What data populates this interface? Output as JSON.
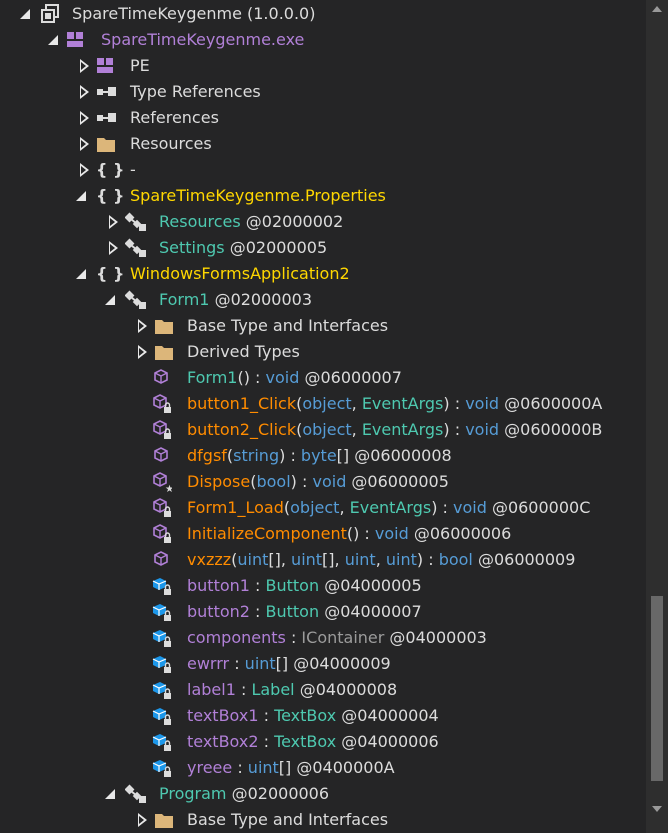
{
  "colors": {
    "background": "#252526",
    "text": "#dcdcdc",
    "namespace": "#ffd700",
    "type": "#4ec9b0",
    "method": "#ff8c00",
    "field": "#b180d7",
    "keyword": "#569cd6",
    "module": "#b180d7"
  },
  "tree": {
    "assembly": "SpareTimeKeygenme (1.0.0.0)",
    "module": "SpareTimeKeygenme.exe",
    "pe": "PE",
    "type_refs": "Type References",
    "refs": "References",
    "resources": "Resources",
    "ns_empty": "-",
    "ns_props": "SpareTimeKeygenme.Properties",
    "props_resources": {
      "name": "Resources",
      "token": " @02000002"
    },
    "props_settings": {
      "name": "Settings",
      "token": " @02000005"
    },
    "ns_wfa": "WindowsFormsApplication2",
    "form1": {
      "name": "Form1",
      "token": " @02000003"
    },
    "base_types": "Base Type and Interfaces",
    "derived_types": "Derived Types",
    "members": [
      {
        "parts": [
          [
            "Form1",
            "c-teal"
          ],
          [
            "()",
            "c-white"
          ],
          [
            " : ",
            "c-white"
          ],
          [
            "void",
            "c-blue"
          ],
          [
            " @06000007",
            "c-white"
          ]
        ],
        "icon": "method"
      },
      {
        "parts": [
          [
            "button1_Click",
            "c-orange"
          ],
          [
            "(",
            "c-white"
          ],
          [
            "object",
            "c-blue"
          ],
          [
            ", ",
            "c-white"
          ],
          [
            "EventArgs",
            "c-tp"
          ],
          [
            ")",
            "c-white"
          ],
          [
            " : ",
            "c-white"
          ],
          [
            "void",
            "c-blue"
          ],
          [
            " @0600000A",
            "c-white"
          ]
        ],
        "icon": "method-private"
      },
      {
        "parts": [
          [
            "button2_Click",
            "c-orange"
          ],
          [
            "(",
            "c-white"
          ],
          [
            "object",
            "c-blue"
          ],
          [
            ", ",
            "c-white"
          ],
          [
            "EventArgs",
            "c-tp"
          ],
          [
            ")",
            "c-white"
          ],
          [
            " : ",
            "c-white"
          ],
          [
            "void",
            "c-blue"
          ],
          [
            " @0600000B",
            "c-white"
          ]
        ],
        "icon": "method-private"
      },
      {
        "parts": [
          [
            "dfgsf",
            "c-orange"
          ],
          [
            "(",
            "c-white"
          ],
          [
            "string",
            "c-blue"
          ],
          [
            ")",
            "c-white"
          ],
          [
            " : ",
            "c-white"
          ],
          [
            "byte",
            "c-blue"
          ],
          [
            "[]",
            "c-white"
          ],
          [
            " @06000008",
            "c-white"
          ]
        ],
        "icon": "method"
      },
      {
        "parts": [
          [
            "Dispose",
            "c-orange"
          ],
          [
            "(",
            "c-white"
          ],
          [
            "bool",
            "c-blue"
          ],
          [
            ")",
            "c-white"
          ],
          [
            " : ",
            "c-white"
          ],
          [
            "void",
            "c-blue"
          ],
          [
            " @06000005",
            "c-white"
          ]
        ],
        "icon": "method-protected"
      },
      {
        "parts": [
          [
            "Form1_Load",
            "c-orange"
          ],
          [
            "(",
            "c-white"
          ],
          [
            "object",
            "c-blue"
          ],
          [
            ", ",
            "c-white"
          ],
          [
            "EventArgs",
            "c-tp"
          ],
          [
            ")",
            "c-white"
          ],
          [
            " : ",
            "c-white"
          ],
          [
            "void",
            "c-blue"
          ],
          [
            " @0600000C",
            "c-white"
          ]
        ],
        "icon": "method-private"
      },
      {
        "parts": [
          [
            "InitializeComponent",
            "c-orange"
          ],
          [
            "()",
            "c-white"
          ],
          [
            " : ",
            "c-white"
          ],
          [
            "void",
            "c-blue"
          ],
          [
            " @06000006",
            "c-white"
          ]
        ],
        "icon": "method-private"
      },
      {
        "parts": [
          [
            "vxzzz",
            "c-orange"
          ],
          [
            "(",
            "c-white"
          ],
          [
            "uint",
            "c-blue"
          ],
          [
            "[], ",
            "c-white"
          ],
          [
            "uint",
            "c-blue"
          ],
          [
            "[], ",
            "c-white"
          ],
          [
            "uint",
            "c-blue"
          ],
          [
            ", ",
            "c-white"
          ],
          [
            "uint",
            "c-blue"
          ],
          [
            ")",
            "c-white"
          ],
          [
            " : ",
            "c-white"
          ],
          [
            "bool",
            "c-blue"
          ],
          [
            " @06000009",
            "c-white"
          ]
        ],
        "icon": "method"
      },
      {
        "parts": [
          [
            "button1",
            "c-purple"
          ],
          [
            " : ",
            "c-white"
          ],
          [
            "Button",
            "c-tp"
          ],
          [
            " @04000005",
            "c-white"
          ]
        ],
        "icon": "field"
      },
      {
        "parts": [
          [
            "button2",
            "c-purple"
          ],
          [
            " : ",
            "c-white"
          ],
          [
            "Button",
            "c-tp"
          ],
          [
            " @04000007",
            "c-white"
          ]
        ],
        "icon": "field"
      },
      {
        "parts": [
          [
            "components",
            "c-purple"
          ],
          [
            " : ",
            "c-white"
          ],
          [
            "IContainer",
            "c-gray"
          ],
          [
            " @04000003",
            "c-white"
          ]
        ],
        "icon": "field"
      },
      {
        "parts": [
          [
            "ewrrr",
            "c-purple"
          ],
          [
            " : ",
            "c-white"
          ],
          [
            "uint",
            "c-blue"
          ],
          [
            "[]",
            "c-white"
          ],
          [
            " @04000009",
            "c-white"
          ]
        ],
        "icon": "field"
      },
      {
        "parts": [
          [
            "label1",
            "c-purple"
          ],
          [
            " : ",
            "c-white"
          ],
          [
            "Label",
            "c-tp"
          ],
          [
            " @04000008",
            "c-white"
          ]
        ],
        "icon": "field"
      },
      {
        "parts": [
          [
            "textBox1",
            "c-purple"
          ],
          [
            " : ",
            "c-white"
          ],
          [
            "TextBox",
            "c-tp"
          ],
          [
            " @04000004",
            "c-white"
          ]
        ],
        "icon": "field"
      },
      {
        "parts": [
          [
            "textBox2",
            "c-purple"
          ],
          [
            " : ",
            "c-white"
          ],
          [
            "TextBox",
            "c-tp"
          ],
          [
            " @04000006",
            "c-white"
          ]
        ],
        "icon": "field"
      },
      {
        "parts": [
          [
            "yreee",
            "c-purple"
          ],
          [
            " : ",
            "c-white"
          ],
          [
            "uint",
            "c-blue"
          ],
          [
            "[]",
            "c-white"
          ],
          [
            " @0400000A",
            "c-white"
          ]
        ],
        "icon": "field"
      }
    ],
    "program": {
      "name": "Program",
      "token": " @02000006"
    },
    "program_base": "Base Type and Interfaces"
  }
}
